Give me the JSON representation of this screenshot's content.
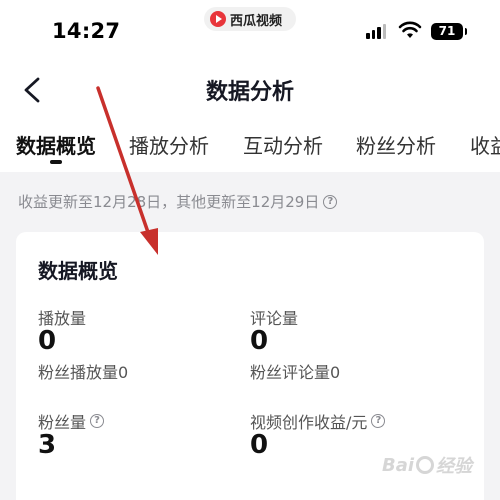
{
  "status_bar": {
    "time": "14:27",
    "app_name": "西瓜视频",
    "battery": "71"
  },
  "header": {
    "title": "数据分析"
  },
  "tabs": [
    {
      "label": "数据概览",
      "active": true
    },
    {
      "label": "播放分析",
      "active": false
    },
    {
      "label": "互动分析",
      "active": false
    },
    {
      "label": "粉丝分析",
      "active": false
    },
    {
      "label": "收益",
      "active": false
    }
  ],
  "notice": "收益更新至12月28日，其他更新至12月29日",
  "overview": {
    "title": "数据概览",
    "play_count": {
      "label": "播放量",
      "value": "0",
      "sub": "粉丝播放量0"
    },
    "comment_count": {
      "label": "评论量",
      "value": "0",
      "sub": "粉丝评论量0"
    },
    "fans_count": {
      "label": "粉丝量",
      "value": "3"
    },
    "revenue": {
      "label": "视频创作收益/元",
      "value": "0"
    }
  },
  "watermark": {
    "text_left": "Bai",
    "text_right": "经验"
  },
  "colors": {
    "arrow": "#c8302c",
    "app_logo": "#e8353b",
    "page_bg": "#f3f3f5"
  }
}
